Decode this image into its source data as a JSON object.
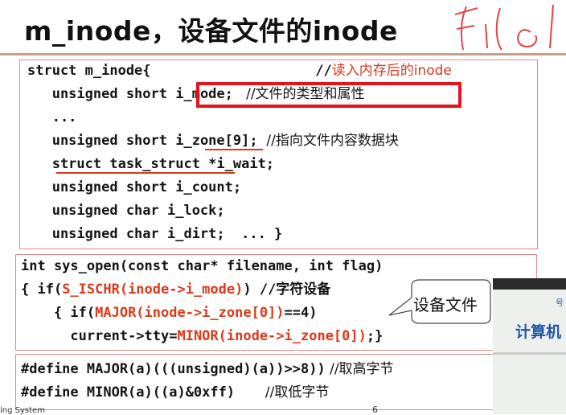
{
  "slide": {
    "title": "m_inode，设备文件的inode",
    "scribble_text": "File",
    "footer_left": "ing System",
    "page_number": "6"
  },
  "struct_block": {
    "l1_code": "struct m_inode{",
    "l1_comment_prefix": "//",
    "l1_comment_red": "读入内存后的inode",
    "l2_code": "   unsigned short ",
    "l2_field": "i_mode;",
    "l2_comment": "   //文件的类型和属性",
    "l3": "   ...",
    "l4_code": "   unsigned short ",
    "l4_field": "i_zone[9];",
    "l4_comment": "  //指向文件内容数据块",
    "l5": "   struct task_struct *i_wait;",
    "l6": "   unsigned short i_count;",
    "l7": "   unsigned char i_lock;",
    "l8": "   unsigned char i_dirt;  ... }"
  },
  "open_block": {
    "l1": "int sys_open(const char* filename, int flag)",
    "l2_a": "{ if(",
    "l2_red": "S_ISCHR(inode->i_mode)",
    "l2_b": ") //字符设备",
    "l3_a": "    { if(",
    "l3_red": "MAJOR(inode->i_zone[0])",
    "l3_b": "==4)",
    "l4_a": "      current->tty=",
    "l4_red": "MINOR(inode->i_zone[0])",
    "l4_b": ";}",
    "callout": "设备文件"
  },
  "define_block": {
    "l1_code": "#define MAJOR(a)(((unsigned)(a))>>8))",
    "l1_comment": " //取高字节",
    "l2_code": "#define MINOR(a)((a)&0xff)",
    "l2_comment": "       //取低字节"
  },
  "photo": {
    "small": "号",
    "text": "计算机"
  },
  "colors": {
    "accent_red": "#d93a1a",
    "box_border": "#d98a8a",
    "highlight_box": "#e5131c",
    "title_rule": "#c7a08a"
  }
}
